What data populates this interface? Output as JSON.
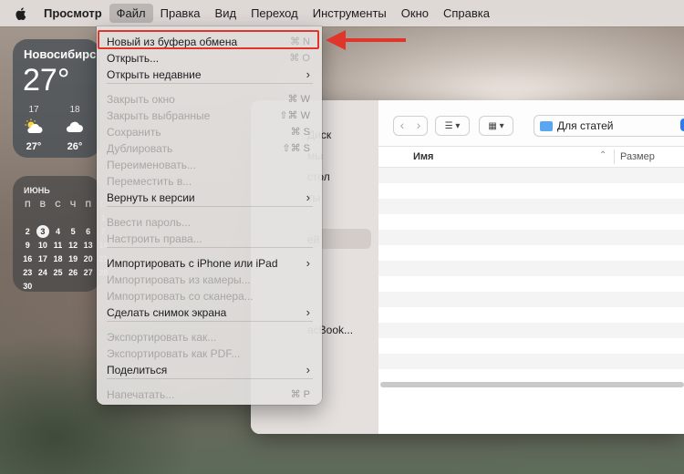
{
  "menubar": {
    "app_name": "Просмотр",
    "items": [
      "Файл",
      "Правка",
      "Вид",
      "Переход",
      "Инструменты",
      "Окно",
      "Справка"
    ],
    "active_item": "Файл"
  },
  "weather": {
    "city": "Новосибирс",
    "temperature": "27°",
    "forecast": [
      {
        "hour": "17",
        "icon": "sun-cloud-icon",
        "temp": "27°"
      },
      {
        "hour": "18",
        "icon": "cloud-icon",
        "temp": "26°"
      }
    ]
  },
  "calendar": {
    "month": "ИЮНЬ",
    "weekdays": [
      "П",
      "В",
      "С",
      "Ч",
      "П",
      "С"
    ],
    "days": [
      "",
      "",
      "",
      "",
      "",
      "1",
      "2",
      "3",
      "4",
      "5",
      "6",
      "7",
      "9",
      "10",
      "11",
      "12",
      "13",
      "14",
      "16",
      "17",
      "18",
      "19",
      "20",
      "21",
      "23",
      "24",
      "25",
      "26",
      "27",
      "28",
      "30",
      "",
      "",
      "",
      "",
      ""
    ],
    "today": "3"
  },
  "finder": {
    "sidebar_fragments": [
      "Диск",
      "мы",
      "стол",
      "ты",
      "ей",
      "acBook..."
    ],
    "path_label": "Для статей",
    "columns": {
      "name": "Имя",
      "size": "Размер"
    }
  },
  "file_menu": {
    "items": [
      {
        "label": "Новый из буфера обмена",
        "shortcut": "⌘ N",
        "enabled": true
      },
      {
        "label": "Открыть...",
        "shortcut": "⌘ O",
        "enabled": true
      },
      {
        "label": "Открыть недавние",
        "submenu": true,
        "enabled": true
      },
      {
        "label": "Закрыть окно",
        "shortcut": "⌘ W",
        "enabled": false
      },
      {
        "label": "Закрыть выбранные",
        "shortcut": "⇧⌘ W",
        "enabled": false
      },
      {
        "label": "Сохранить",
        "shortcut": "⌘ S",
        "enabled": false
      },
      {
        "label": "Дублировать",
        "shortcut": "⇧⌘ S",
        "enabled": false
      },
      {
        "label": "Переименовать...",
        "enabled": false
      },
      {
        "label": "Переместить в...",
        "enabled": false
      },
      {
        "label": "Вернуть к версии",
        "submenu": true,
        "enabled": true
      },
      {
        "label": "Ввести пароль...",
        "enabled": false
      },
      {
        "label": "Настроить права...",
        "enabled": false
      },
      {
        "label": "Импортировать с iPhone или iPad",
        "submenu": true,
        "enabled": true
      },
      {
        "label": "Импортировать из камеры...",
        "enabled": false
      },
      {
        "label": "Импортировать со сканера...",
        "enabled": false
      },
      {
        "label": "Сделать снимок экрана",
        "submenu": true,
        "enabled": true
      },
      {
        "label": "Экспортировать как...",
        "enabled": false
      },
      {
        "label": "Экспортировать как PDF...",
        "enabled": false
      },
      {
        "label": "Поделиться",
        "submenu": true,
        "enabled": true
      },
      {
        "label": "Напечатать...",
        "shortcut": "⌘ P",
        "enabled": false
      }
    ]
  },
  "colors": {
    "annotation": "#e0352a",
    "accent": "#2d7be5"
  }
}
